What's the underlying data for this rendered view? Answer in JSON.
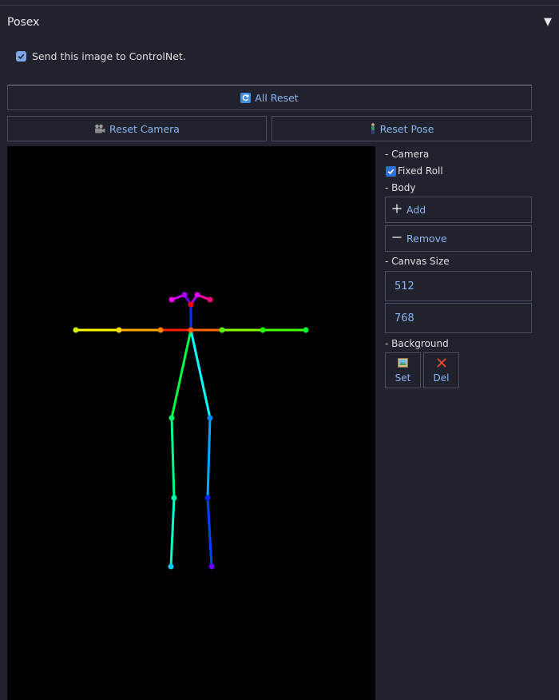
{
  "panel": {
    "title": "Posex",
    "collapse_icon": "triangle-down-icon"
  },
  "send_checkbox": {
    "label": "Send this image to ControlNet.",
    "checked": true
  },
  "buttons": {
    "all_reset": "All Reset",
    "reset_camera": "Reset Camera",
    "reset_pose": "Reset Pose"
  },
  "sidebar": {
    "camera_label": "- Camera",
    "fixed_roll_label": "Fixed Roll",
    "fixed_roll_checked": true,
    "body_label": "- Body",
    "add_label": "Add",
    "remove_label": "Remove",
    "canvas_size_label": "- Canvas Size",
    "canvas_width": "512",
    "canvas_height": "768",
    "background_label": "- Background",
    "set_label": "Set",
    "del_label": "Del"
  },
  "colors": {
    "accent": "#8db4ef",
    "background": "#20222e",
    "border": "#4a4e60"
  }
}
